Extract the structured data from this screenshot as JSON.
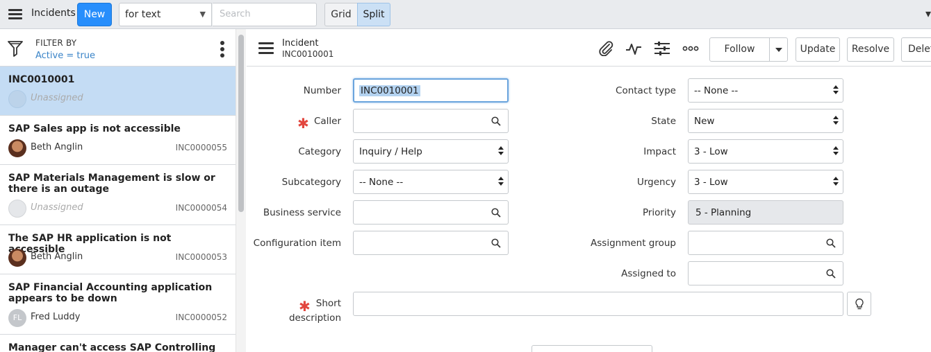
{
  "topbar": {
    "title": "Incidents",
    "new_label": "New",
    "search_field_value": "for text",
    "search_placeholder": "Search",
    "grid_label": "Grid",
    "split_label": "Split"
  },
  "filter": {
    "label": "FILTER BY",
    "condition": "Active = true"
  },
  "list": {
    "items": [
      {
        "title": "INC0010001",
        "user": "Unassigned",
        "number": ""
      },
      {
        "title": "SAP Sales app is not accessible",
        "user": "Beth Anglin",
        "number": "INC0000055"
      },
      {
        "title": "SAP Materials Management is slow or there is an outage",
        "user": "Unassigned",
        "number": "INC0000054"
      },
      {
        "title": "The SAP HR application is not accessible",
        "user": "Beth Anglin",
        "number": "INC0000053"
      },
      {
        "title": "SAP Financial Accounting application appears to be down",
        "user": "Fred Luddy",
        "initials": "FL",
        "number": "INC0000052"
      },
      {
        "title": "Manager can't access SAP Controlling"
      }
    ]
  },
  "form_header": {
    "label": "Incident",
    "number": "INC0010001",
    "follow_label": "Follow",
    "update_label": "Update",
    "resolve_label": "Resolve",
    "delete_label": "Delete"
  },
  "form": {
    "number": {
      "label": "Number",
      "value": "INC0010001"
    },
    "caller": {
      "label": "Caller",
      "value": ""
    },
    "category": {
      "label": "Category",
      "value": "Inquiry / Help"
    },
    "subcategory": {
      "label": "Subcategory",
      "value": "-- None --"
    },
    "business_service": {
      "label": "Business service",
      "value": ""
    },
    "configuration_item": {
      "label": "Configuration item",
      "value": ""
    },
    "contact_type": {
      "label": "Contact type",
      "value": "-- None --"
    },
    "state": {
      "label": "State",
      "value": "New"
    },
    "impact": {
      "label": "Impact",
      "value": "3 - Low"
    },
    "urgency": {
      "label": "Urgency",
      "value": "3 - Low"
    },
    "priority": {
      "label": "Priority",
      "value": "5 - Planning"
    },
    "assignment_group": {
      "label": "Assignment group",
      "value": ""
    },
    "assigned_to": {
      "label": "Assigned to",
      "value": ""
    },
    "short_description": {
      "label_line1": "Short",
      "label_line2": "description",
      "value": ""
    }
  },
  "colors": {
    "accent": "#278efc",
    "selected_row": "#c4dcf4",
    "link": "#3a84c8",
    "required": "#e2463e"
  },
  "icons": [
    "menu-icon",
    "filter-funnel-icon",
    "kebab-icon",
    "attachment-icon",
    "activity-icon",
    "settings-sliders-icon",
    "more-icon",
    "search-icon",
    "lightbulb-icon"
  ]
}
